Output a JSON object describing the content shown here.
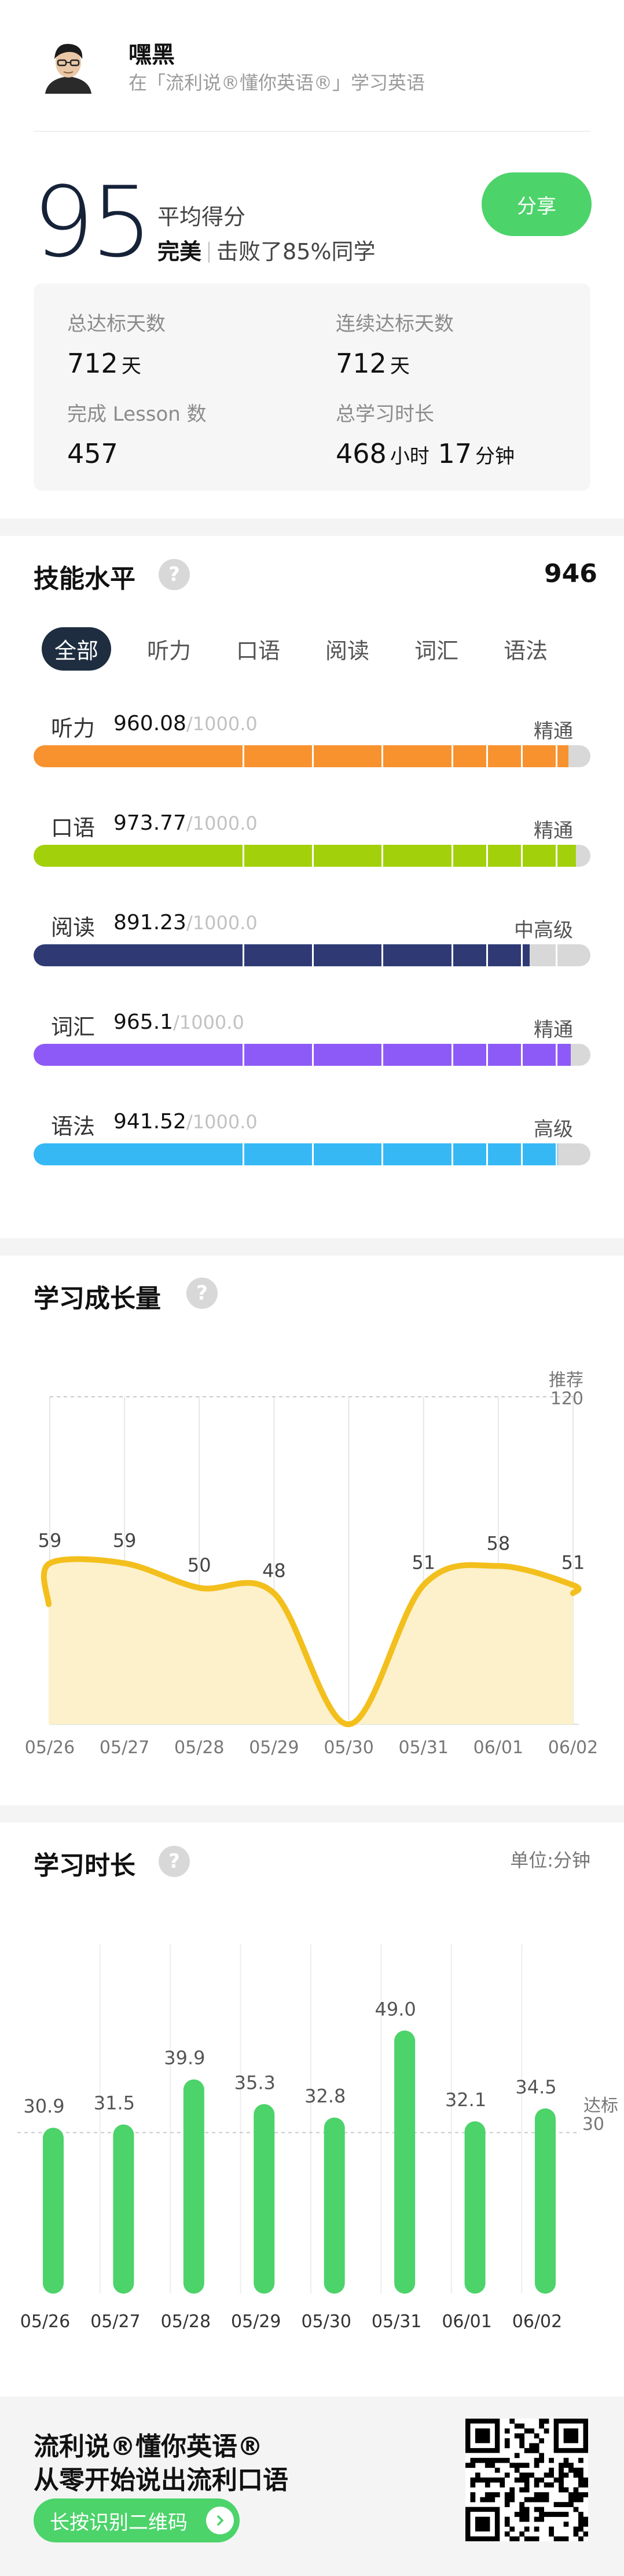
{
  "user": {
    "name": "嘿黑",
    "subtitle": "在「流利说®懂你英语®」学习英语"
  },
  "score": {
    "value": "95",
    "label": "平均得分",
    "rank_word": "完美",
    "rank_text": "击败了85%同学",
    "share_label": "分享"
  },
  "stats": {
    "total_days_label": "总达标天数",
    "total_days_value": "712",
    "total_days_unit": "天",
    "streak_label": "连续达标天数",
    "streak_value": "712",
    "streak_unit": "天",
    "lessons_label": "完成 Lesson 数",
    "lessons_value": "457",
    "time_label": "总学习时长",
    "time_hours": "468",
    "time_hours_unit": "小时",
    "time_minutes": "17",
    "time_minutes_unit": "分钟"
  },
  "skills": {
    "title": "技能水平",
    "total": "946",
    "help": "?",
    "tabs": [
      "全部",
      "听力",
      "口语",
      "阅读",
      "词汇",
      "语法"
    ],
    "active_tab": 0,
    "items": [
      {
        "name": "听力",
        "value": "960.08",
        "max": "/1000.0",
        "level": "精通",
        "fraction": 0.96008,
        "color": "#f7922f"
      },
      {
        "name": "口语",
        "value": "973.77",
        "max": "/1000.0",
        "level": "精通",
        "fraction": 0.97377,
        "color": "#a2d10c"
      },
      {
        "name": "阅读",
        "value": "891.23",
        "max": "/1000.0",
        "level": "中高级",
        "fraction": 0.89123,
        "color": "#2f3a74"
      },
      {
        "name": "词汇",
        "value": "965.1",
        "max": "/1000.0",
        "level": "精通",
        "fraction": 0.9651,
        "color": "#8e5af7"
      },
      {
        "name": "语法",
        "value": "941.52",
        "max": "/1000.0",
        "level": "高级",
        "fraction": 0.94152,
        "color": "#36b8f5"
      }
    ]
  },
  "growth": {
    "title": "学习成长量",
    "help": "?",
    "ref_label": "推荐",
    "ref_value": "120",
    "chart_data": {
      "type": "area",
      "categories": [
        "05/26",
        "05/27",
        "05/28",
        "05/29",
        "05/30",
        "05/31",
        "06/01",
        "06/02"
      ],
      "values": [
        59,
        59,
        50,
        48,
        0,
        51,
        58,
        51
      ],
      "value_labels": [
        "59",
        "59",
        "50",
        "48",
        "",
        "51",
        "58",
        "51"
      ],
      "reference_line": 120,
      "ylim": [
        0,
        120
      ],
      "line_color": "#f3bf1c",
      "fill_color": "#fdf1cc"
    }
  },
  "time": {
    "title": "学习时长",
    "help": "?",
    "unit_label": "单位:分钟",
    "ref_label": "达标",
    "ref_value": "30",
    "chart_data": {
      "type": "bar",
      "categories": [
        "05/26",
        "05/27",
        "05/28",
        "05/29",
        "05/30",
        "05/31",
        "06/01",
        "06/02"
      ],
      "values": [
        30.9,
        31.5,
        39.9,
        35.3,
        32.8,
        49.0,
        32.1,
        34.5
      ],
      "value_labels": [
        "30.9",
        "31.5",
        "39.9",
        "35.3",
        "32.8",
        "49.0",
        "32.1",
        "34.5"
      ],
      "reference_line": 30,
      "ylim": [
        0,
        50
      ],
      "bar_color": "#4cd36a"
    }
  },
  "footer": {
    "line1": "流利说®懂你英语®",
    "line2": "从零开始说出流利口语",
    "button_label": "长按识别二维码"
  }
}
